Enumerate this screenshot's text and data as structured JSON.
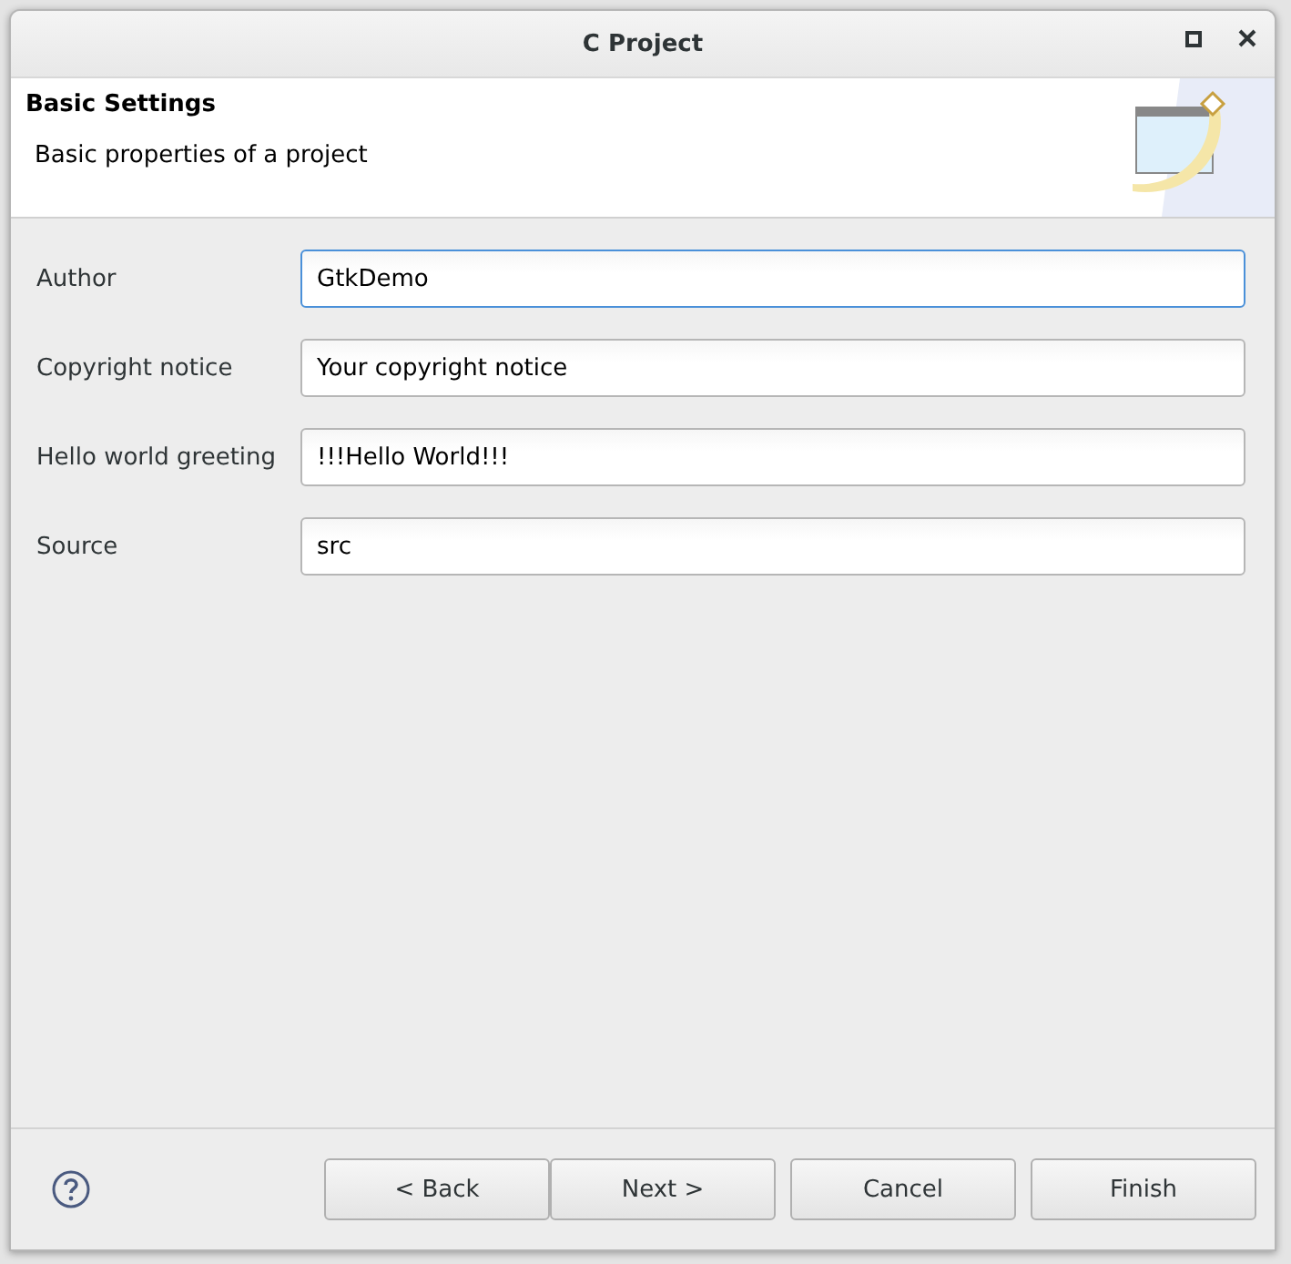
{
  "window": {
    "title": "C Project"
  },
  "header": {
    "title": "Basic Settings",
    "description": "Basic properties of a project"
  },
  "fields": [
    {
      "label": "Author",
      "value": "GtkDemo",
      "focused": true
    },
    {
      "label": "Copyright notice",
      "value": "Your copyright notice",
      "focused": false
    },
    {
      "label": "Hello world greeting",
      "value": "!!!Hello World!!!",
      "focused": false
    },
    {
      "label": "Source",
      "value": "src",
      "focused": false
    }
  ],
  "buttons": [
    {
      "label": "< Back"
    },
    {
      "label": "Next >"
    },
    {
      "label": "Cancel"
    },
    {
      "label": "Finish"
    }
  ]
}
